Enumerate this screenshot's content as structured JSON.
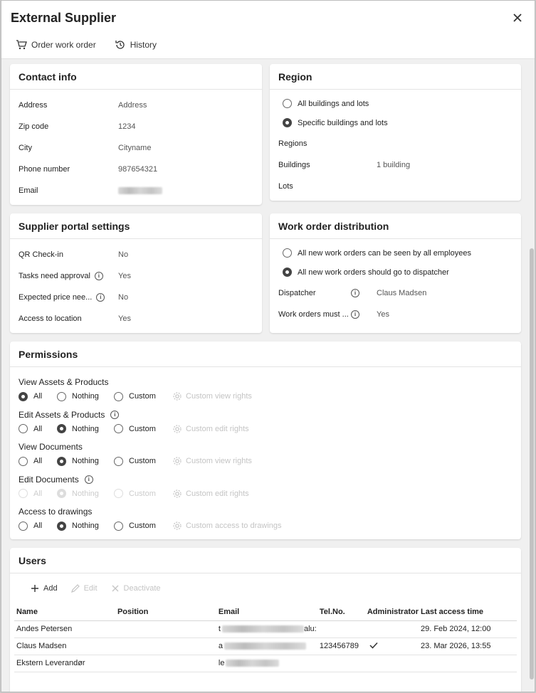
{
  "dialog": {
    "title": "External Supplier",
    "toolbar": {
      "order": "Order work order",
      "history": "History"
    }
  },
  "contact": {
    "title": "Contact info",
    "rows": [
      {
        "label": "Address",
        "value": "Address"
      },
      {
        "label": "Zip code",
        "value": "1234"
      },
      {
        "label": "City",
        "value": "Cityname"
      },
      {
        "label": "Phone number",
        "value": "987654321"
      },
      {
        "label": "Email",
        "value": ""
      }
    ]
  },
  "region": {
    "title": "Region",
    "options": [
      "All buildings and lots",
      "Specific buildings and lots"
    ],
    "selected": 1,
    "rows": [
      {
        "label": "Regions",
        "value": ""
      },
      {
        "label": "Buildings",
        "value": "1 building"
      },
      {
        "label": "Lots",
        "value": ""
      }
    ]
  },
  "portal": {
    "title": "Supplier portal settings",
    "rows": [
      {
        "label": "QR Check-in",
        "value": "No",
        "info": false
      },
      {
        "label": "Tasks need approval",
        "value": "Yes",
        "info": true
      },
      {
        "label": "Expected price nee...",
        "value": "No",
        "info": true
      },
      {
        "label": "Access to location",
        "value": "Yes",
        "info": false
      }
    ]
  },
  "distribution": {
    "title": "Work order distribution",
    "options": [
      "All new work orders can be seen by all employees",
      "All new work orders should go to dispatcher"
    ],
    "selected": 1,
    "rows": [
      {
        "label": "Dispatcher",
        "value": "Claus Madsen"
      },
      {
        "label": "Work orders must ...",
        "value": "Yes"
      }
    ]
  },
  "permissions": {
    "title": "Permissions",
    "opt_all": "All",
    "opt_nothing": "Nothing",
    "opt_custom": "Custom",
    "groups": [
      {
        "label": "View Assets & Products",
        "selected": 0,
        "custom": "Custom view rights",
        "info": false,
        "disabled": false
      },
      {
        "label": "Edit Assets & Products",
        "selected": 1,
        "custom": "Custom edit rights",
        "info": true,
        "disabled": false
      },
      {
        "label": "View Documents",
        "selected": 1,
        "custom": "Custom view rights",
        "info": false,
        "disabled": false
      },
      {
        "label": "Edit Documents",
        "selected": 1,
        "custom": "Custom edit rights",
        "info": true,
        "disabled": true
      },
      {
        "label": "Access to drawings",
        "selected": 1,
        "custom": "Custom access to drawings",
        "info": false,
        "disabled": false
      }
    ]
  },
  "users": {
    "title": "Users",
    "actions": {
      "add": "Add",
      "edit": "Edit",
      "deactivate": "Deactivate"
    },
    "columns": [
      "Name",
      "Position",
      "Email",
      "Tel.No.",
      "Administrator",
      "Last access time"
    ],
    "rows": [
      {
        "name": "Andes Petersen",
        "position": "",
        "email_prefix": "t",
        "email_suffix": "alu:",
        "tel": "",
        "admin": false,
        "last": "29. Feb 2024, 12:00"
      },
      {
        "name": "Claus Madsen",
        "position": "",
        "email_prefix": "a",
        "email_suffix": "",
        "tel": "123456789",
        "admin": true,
        "last": "23. Mar 2026, 13:55"
      },
      {
        "name": "Ekstern Leverandør",
        "position": "",
        "email_prefix": "le",
        "email_suffix": "",
        "tel": "",
        "admin": false,
        "last": ""
      }
    ]
  }
}
